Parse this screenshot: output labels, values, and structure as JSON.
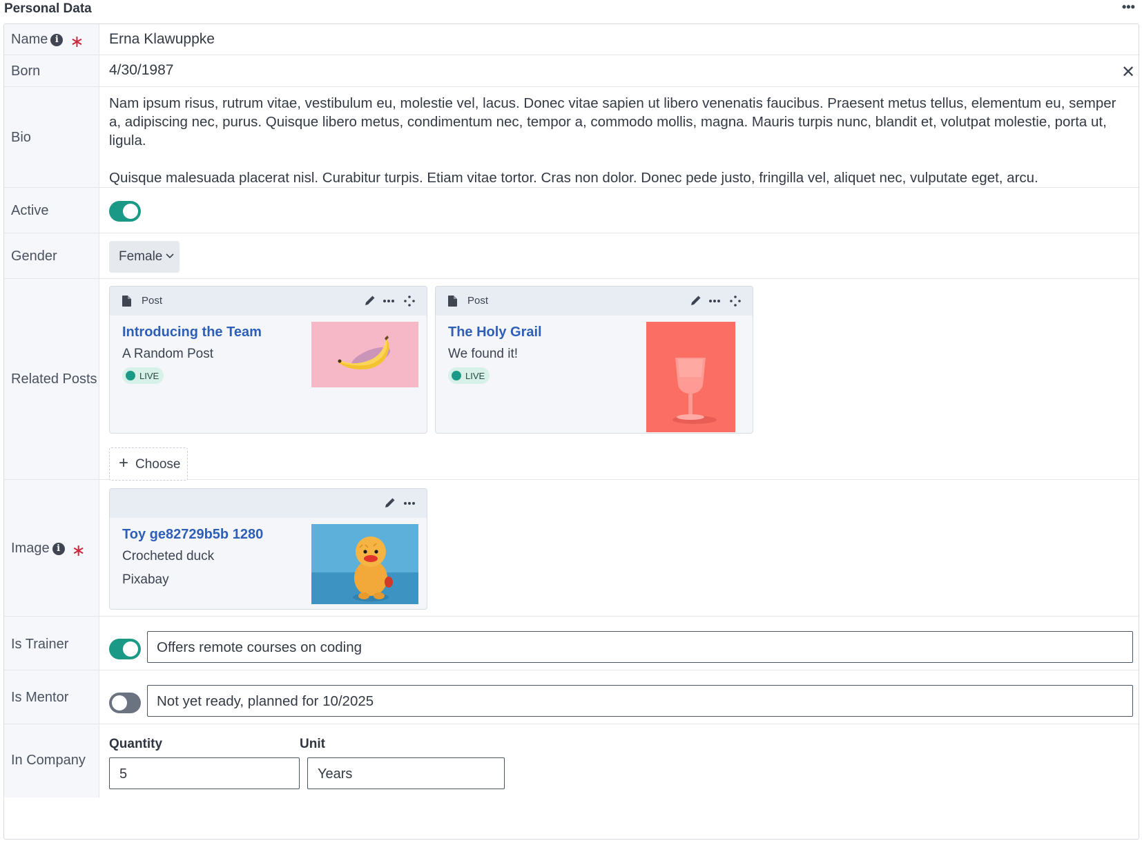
{
  "section": {
    "title": "Personal Data",
    "menu_icon": "•••"
  },
  "fields": {
    "name": {
      "label": "Name",
      "value": "Erna Klawuppke"
    },
    "born": {
      "label": "Born",
      "value": "4/30/1987",
      "clear_icon": "✕"
    },
    "bio": {
      "label": "Bio",
      "paragraph1": "Nam ipsum risus, rutrum vitae, vestibulum eu, molestie vel, lacus. Donec vitae sapien ut libero venenatis faucibus. Praesent metus tellus, elementum eu, semper a, adipiscing nec, purus. Quisque libero metus, condimentum nec, tempor a, commodo mollis, magna. Mauris turpis nunc, blandit et, volutpat molestie, porta ut, ligula.",
      "paragraph2": "Quisque malesuada placerat nisl. Curabitur turpis. Etiam vitae tortor. Cras non dolor. Donec pede justo, fringilla vel, aliquet nec, vulputate eget, arcu."
    },
    "active": {
      "label": "Active",
      "on": true
    },
    "gender": {
      "label": "Gender",
      "selected": "Female"
    },
    "related_posts": {
      "label": "Related Posts",
      "posts": [
        {
          "type": "Post",
          "title": "Introducing the Team",
          "subtitle": "A Random Post",
          "status": "LIVE"
        },
        {
          "type": "Post",
          "title": "The Holy Grail",
          "subtitle": "We found it!",
          "status": "LIVE"
        }
      ],
      "choose_label": "Choose"
    },
    "image": {
      "label": "Image",
      "title": "Toy ge82729b5b 1280",
      "description": "Crocheted duck",
      "credit": "Pixabay"
    },
    "is_trainer": {
      "label": "Is Trainer",
      "on": true,
      "note": "Offers remote courses on coding"
    },
    "is_mentor": {
      "label": "Is Mentor",
      "on": false,
      "note": "Not yet ready, planned for 10/2025"
    },
    "in_company": {
      "label": "In Company",
      "quantity_label": "Quantity",
      "quantity_value": "5",
      "unit_label": "Unit",
      "unit_value": "Years"
    }
  },
  "colors": {
    "accent": "#1a9a86",
    "link": "#2d5fb8",
    "required": "#d0243a",
    "label_bg": "#f5f7fa"
  }
}
